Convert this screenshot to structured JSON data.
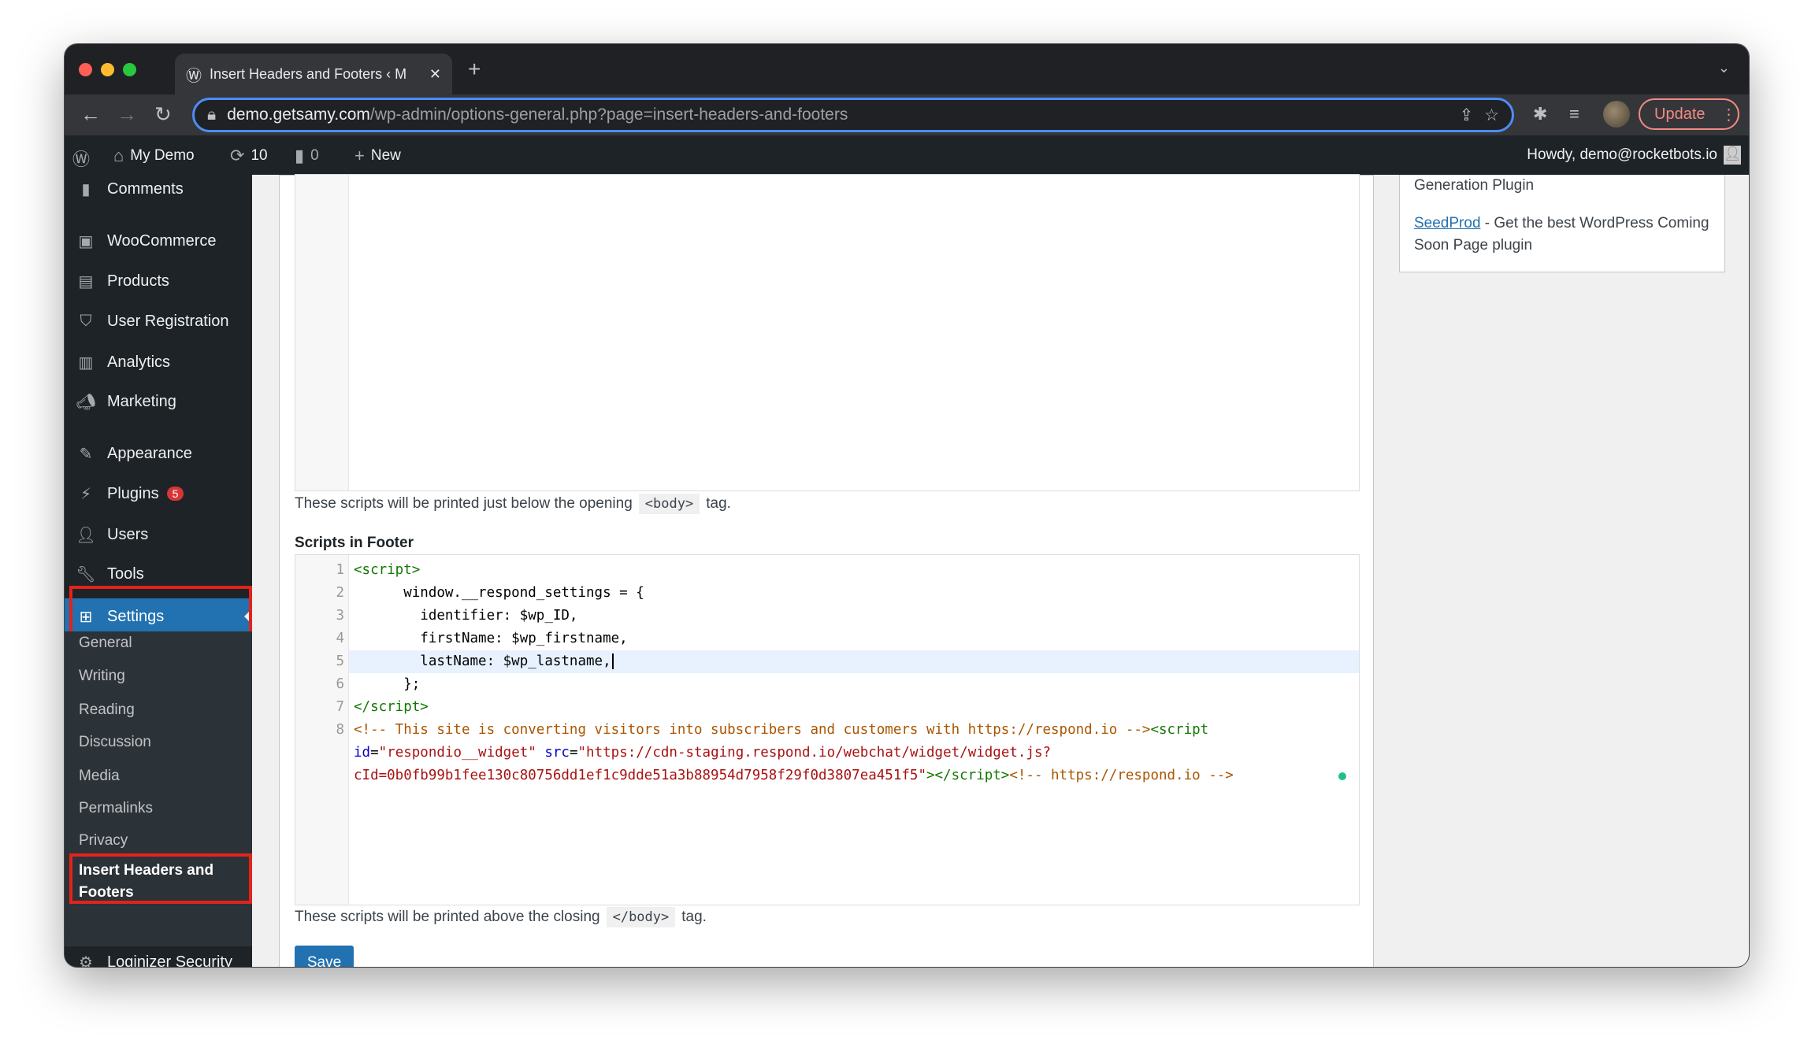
{
  "browser": {
    "tab_title": "Insert Headers and Footers ‹ M",
    "url_host": "demo.getsamy.com",
    "url_path": "/wp-admin/options-general.php?page=insert-headers-and-footers",
    "update_label": "Update"
  },
  "adminbar": {
    "site": "My Demo",
    "updates": "10",
    "comments": "0",
    "new": "New",
    "howdy": "Howdy, demo@rocketbots.io"
  },
  "sidebar": {
    "items": [
      {
        "label": "Comments",
        "icon": "comment-icon"
      },
      {
        "label": "WooCommerce",
        "icon": "woo-icon"
      },
      {
        "label": "Products",
        "icon": "archive-icon"
      },
      {
        "label": "User Registration",
        "icon": "shield-icon"
      },
      {
        "label": "Analytics",
        "icon": "bar-chart-icon"
      },
      {
        "label": "Marketing",
        "icon": "megaphone-icon"
      },
      {
        "label": "Appearance",
        "icon": "brush-icon"
      },
      {
        "label": "Plugins",
        "icon": "plug-icon",
        "badge": "5"
      },
      {
        "label": "Users",
        "icon": "user-icon"
      },
      {
        "label": "Tools",
        "icon": "wrench-icon"
      },
      {
        "label": "Settings",
        "icon": "settings-icon"
      },
      {
        "label": "Loginizer Security",
        "icon": "gear-icon"
      }
    ],
    "submenu": [
      "General",
      "Writing",
      "Reading",
      "Discussion",
      "Media",
      "Permalinks",
      "Privacy",
      "Insert Headers and Footers"
    ]
  },
  "main": {
    "body_help_before": "These scripts will be printed just below the opening",
    "body_tag": "<body>",
    "help_after": "tag.",
    "footer_label": "Scripts in Footer",
    "footer_help_before": "These scripts will be printed above the closing",
    "close_body_tag": "</body>",
    "save_label": "Save",
    "code": {
      "l1": "<script>",
      "l2": "      window.__respond_settings = {",
      "l3": "        identifier: $wp_ID,",
      "l4": "        firstName: $wp_firstname,",
      "l5": "        lastName: $wp_lastname,",
      "l6": "      };",
      "l7": "</script>",
      "l8a": "<!-- This site is converting visitors into subscribers and customers with https://respond.io -->",
      "l8b": "<script",
      "l8c_id": "id",
      "l8c_idval": "\"respondio__widget\"",
      "l8c_src": "src",
      "l8c_srcval": "\"https://cdn-staging.respond.io/webchat/widget/widget.js?",
      "l8d_val": "cId=0b0fb99b1fee130c80756dd1ef1c9dde51a3b88954d7958f29f0d3807ea451f5\"",
      "l8d_tag": "></script>",
      "l8d_cm": "<!-- https://respond.io -->"
    }
  },
  "right": {
    "line1": "Generation Plugin",
    "link": "SeedProd",
    "desc": " - Get the best WordPress Coming Soon Page plugin"
  }
}
